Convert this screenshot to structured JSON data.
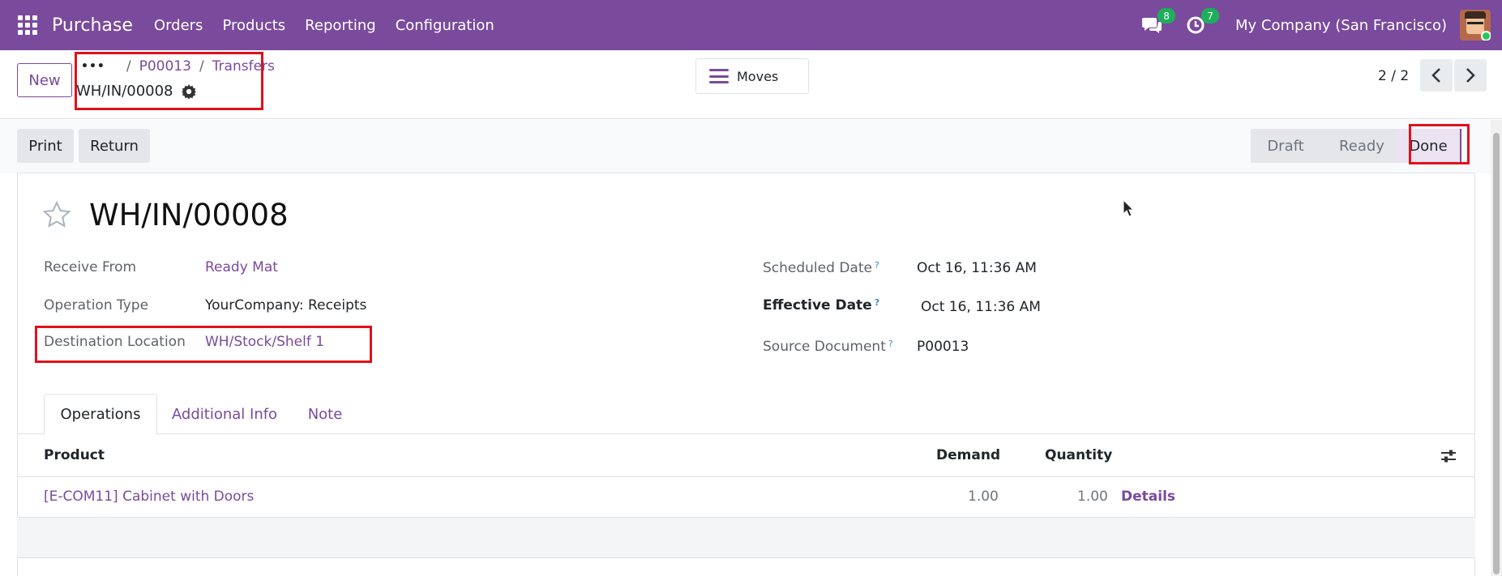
{
  "navbar": {
    "app_name": "Purchase",
    "menu": [
      "Orders",
      "Products",
      "Reporting",
      "Configuration"
    ],
    "messages_count": "8",
    "activities_count": "7",
    "company": "My Company (San Francisco)",
    "color": "#7a4a9c"
  },
  "control": {
    "new_label": "New",
    "breadcrumb": {
      "ellipsis": "•••",
      "items": [
        "P00013",
        "Transfers"
      ]
    },
    "record_name": "WH/IN/00008",
    "moves_label": "Moves",
    "pager": "2 / 2"
  },
  "actions": {
    "print_label": "Print",
    "return_label": "Return",
    "stages": [
      "Draft",
      "Ready",
      "Done"
    ],
    "current_stage": "Done"
  },
  "form": {
    "title": "WH/IN/00008",
    "receive_from_label": "Receive From",
    "receive_from_value": "Ready Mat",
    "operation_type_label": "Operation Type",
    "operation_type_value": "YourCompany: Receipts",
    "destination_label": "Destination Location",
    "destination_value": "WH/Stock/Shelf 1",
    "scheduled_date_label": "Scheduled Date",
    "scheduled_date_value": "Oct 16, 11:36 AM",
    "effective_date_label": "Effective Date",
    "effective_date_value": "Oct 16, 11:36 AM",
    "source_document_label": "Source Document",
    "source_document_value": "P00013",
    "help_mark": "?"
  },
  "tabs": [
    "Operations",
    "Additional Info",
    "Note"
  ],
  "table": {
    "headers": {
      "product": "Product",
      "demand": "Demand",
      "quantity": "Quantity"
    },
    "rows": [
      {
        "product": "[E-COM11] Cabinet with Doors",
        "demand": "1.00",
        "quantity": "1.00",
        "details": "Details"
      }
    ]
  }
}
